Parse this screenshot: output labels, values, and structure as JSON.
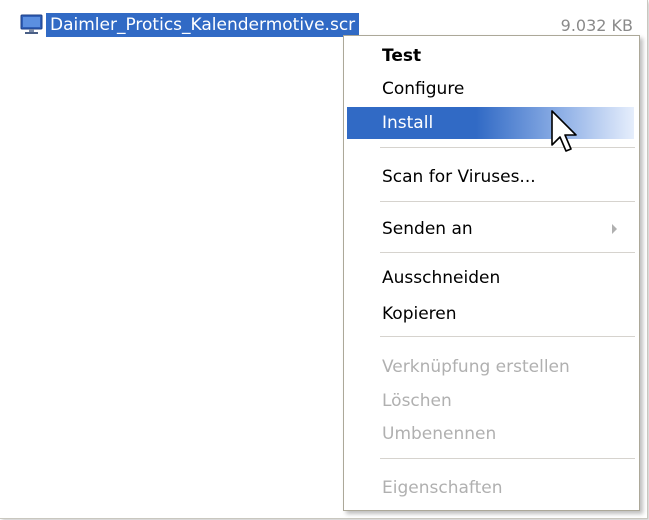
{
  "file": {
    "name": "Daimler_Protics_Kalendermotive.scr",
    "size": "9.032 KB",
    "icon": "screensaver-icon"
  },
  "context_menu": {
    "items": [
      {
        "label": "Test",
        "bold": true
      },
      {
        "label": "Configure"
      },
      {
        "label": "Install",
        "highlighted": true
      },
      {
        "label": "Scan for Viruses..."
      },
      {
        "label": "Senden an",
        "has_submenu": true
      },
      {
        "label": "Ausschneiden"
      },
      {
        "label": "Kopieren"
      },
      {
        "label": "Verknüpfung erstellen",
        "disabled": true
      },
      {
        "label": "Löschen",
        "disabled": true
      },
      {
        "label": "Umbenennen",
        "disabled": true
      },
      {
        "label": "Eigenschaften",
        "disabled": true
      }
    ]
  },
  "colors": {
    "selection": "#316ac5",
    "disabled_text": "#b0b0b0",
    "separator": "#d6d3ce"
  },
  "cursor": "mouse-pointer-icon"
}
